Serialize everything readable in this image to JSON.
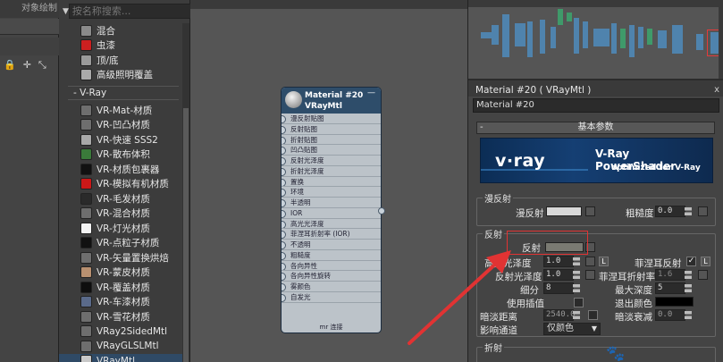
{
  "left_strip": {
    "title": "对象绘制",
    "tool_icons": [
      "lock-icon",
      "select-plus-icon",
      "scale-icon"
    ]
  },
  "browser": {
    "search_placeholder": "按名称搜索...",
    "top_items": [
      {
        "label": "混合",
        "color": "#8a8a8a"
      },
      {
        "label": "虫漆",
        "color": "#cc2020"
      },
      {
        "label": "顶/底",
        "color": "#9a9a9a"
      },
      {
        "label": "高级照明覆盖",
        "color": "#aaaaaa"
      }
    ],
    "group_label": "- V-Ray",
    "vray_items": [
      {
        "label": "VR-Mat-材质",
        "color": "#6e6e6e"
      },
      {
        "label": "VR-凹凸材质",
        "color": "#6e6e6e"
      },
      {
        "label": "VR-快速 SSS2",
        "color": "#a8a8a8"
      },
      {
        "label": "VR-散布体积",
        "color": "#3a7a3a"
      },
      {
        "label": "VR-材质包裹器",
        "color": "#111111"
      },
      {
        "label": "VR-模拟有机材质",
        "color": "#cc1818"
      },
      {
        "label": "VR-毛发材质",
        "color": "#2a2a2a"
      },
      {
        "label": "VR-混合材质",
        "color": "#6e6e6e"
      },
      {
        "label": "VR-灯光材质",
        "color": "#f4f4f4"
      },
      {
        "label": "VR-点粒子材质",
        "color": "#111111"
      },
      {
        "label": "VR-矢量置换烘焙",
        "color": "#6e6e6e"
      },
      {
        "label": "VR-蒙皮材质",
        "color": "#b89070"
      },
      {
        "label": "VR-覆盖材质",
        "color": "#0e0e0e"
      },
      {
        "label": "VR-车漆材质",
        "color": "#5a6a8a"
      },
      {
        "label": "VR-雪花材质",
        "color": "#6e6e6e"
      },
      {
        "label": "VRay2SidedMtl",
        "color": "#6e6e6e"
      },
      {
        "label": "VRayGLSLMtl",
        "color": "#6e6e6e"
      },
      {
        "label": "VRayMtl",
        "color": "#c8c8c8"
      }
    ]
  },
  "node": {
    "title1": "Material #20",
    "title2": "VRayMtl",
    "slots": [
      "漫反射贴图",
      "反射贴图",
      "折射贴图",
      "凹凸贴图",
      "反射光泽度",
      "折射光泽度",
      "置换",
      "环境",
      "半透明",
      "IOR",
      "高光光泽度",
      "菲涅耳折射率 (IOR)",
      "不透明",
      "粗糙度",
      "各向异性",
      "各向异性旋转",
      "雾颜色",
      "自发光"
    ],
    "footer": "mr 连接"
  },
  "editor": {
    "title": "Material #20  ( VRayMtl )",
    "close": "x",
    "name_value": "Material #20",
    "rollout_title": "基本参数",
    "rollout_sign": "-",
    "banner_logo": "v·ray",
    "banner_title": "V-Ray PowerShader",
    "banner_sub": "optimized for V-Ray",
    "diffuse": {
      "group": "漫反射",
      "label": "漫反射",
      "color": "#d8d8d8",
      "rough_label": "粗糙度",
      "rough_value": "0.0"
    },
    "reflect": {
      "group": "反射",
      "label": "反射",
      "color": "#7a7a72",
      "hilight_label": "高光光泽度",
      "hilight_value": "1.0",
      "l_btn": "L",
      "fresnel_label": "菲涅耳反射",
      "fresnel_checked": "✓",
      "fresnel_l": "L",
      "gloss_label": "反射光泽度",
      "gloss_value": "1.0",
      "fresnel_ior_label": "菲涅耳折射率",
      "fresnel_ior_value": "1.6",
      "subdivs_label": "细分",
      "subdivs_value": "8",
      "maxdepth_label": "最大深度",
      "maxdepth_value": "5",
      "interp_label": "使用插值",
      "exitcolor_label": "退出颜色",
      "exit_color": "#000000",
      "dimdist_label": "暗淡距离",
      "dimdist_value": "2540.0",
      "dimfalloff_label": "暗淡衰减",
      "dimfalloff_value": "0.0",
      "affect_label": "影响通道",
      "affect_value": "仅颜色"
    },
    "refract": {
      "group": "折射"
    }
  },
  "watermark": "🐾"
}
